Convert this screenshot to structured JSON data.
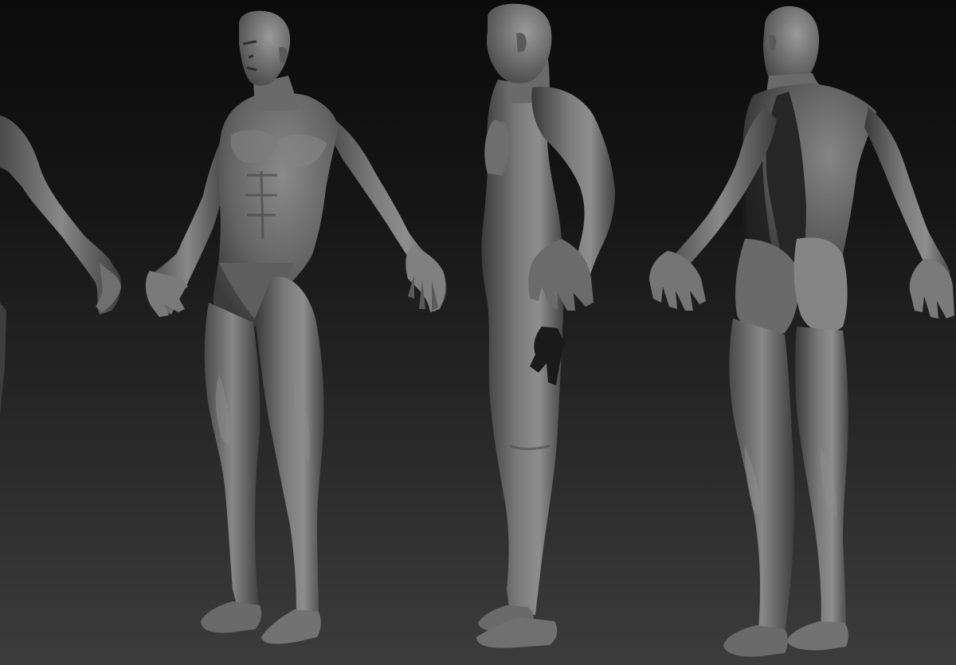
{
  "scene": {
    "type": "3d-sculpt-turnaround",
    "material": "matcap-grey",
    "background_gradient": [
      "#0b0b0b",
      "#3c3c3c"
    ],
    "views": [
      "front-three-quarter",
      "side",
      "back-three-quarter"
    ]
  },
  "colors": {
    "skin_dark": "#3a3a3a",
    "skin_mid": "#5e5e5e",
    "skin_light": "#9a9a9a",
    "shadow": "#1a1a1a"
  }
}
